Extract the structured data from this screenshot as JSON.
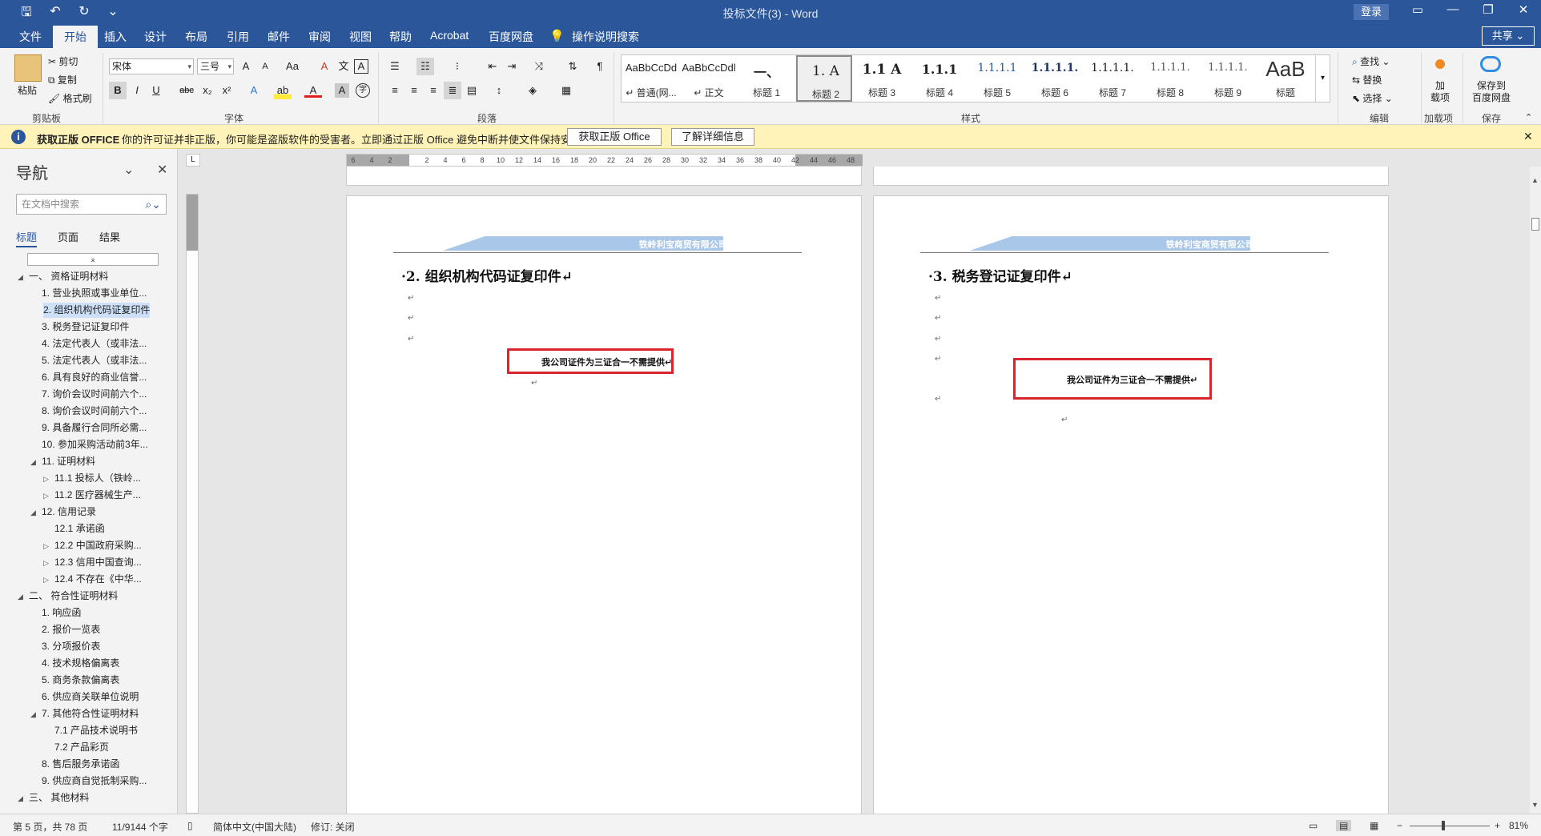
{
  "title_bar": {
    "doc_title": "投标文件(3)  -  Word",
    "login": "登录",
    "qat_icons": [
      "save-icon",
      "undo-icon",
      "redo-icon",
      "customize-icon"
    ],
    "save": "🖫",
    "undo": "↶",
    "redo": "↻",
    "customize": "⌄",
    "ribbon_display": "▭",
    "minimize": "—",
    "restore": "❐",
    "close": "✕"
  },
  "tabs": {
    "file": "文件",
    "home": "开始",
    "insert": "插入",
    "design": "设计",
    "layout": "布局",
    "references": "引用",
    "mailings": "邮件",
    "review": "审阅",
    "view": "视图",
    "help": "帮助",
    "acrobat": "Acrobat",
    "baidu": "百度网盘",
    "tell_me": "操作说明搜索",
    "share": "共享 ⌄"
  },
  "ribbon": {
    "clipboard": {
      "paste": "粘贴",
      "cut": "剪切",
      "copy": "复制",
      "format_painter": "格式刷",
      "label": "剪贴板"
    },
    "font": {
      "name": "宋体",
      "size": "三号",
      "label": "字体",
      "grow": "A",
      "shrink": "A",
      "case": "Aa",
      "clear": "A",
      "phonetic": "文",
      "border": "A",
      "bold": "B",
      "italic": "I",
      "underline": "U",
      "strike": "abc",
      "sub": "x₂",
      "sup": "x²",
      "effects": "A",
      "highlight": "ab",
      "color": "A",
      "shade": "A",
      "enclose": "字"
    },
    "paragraph": {
      "label": "段落"
    },
    "styles": {
      "label": "样式",
      "items": [
        {
          "preview": "AaBbCcDd",
          "name": "↵ 普通(网..."
        },
        {
          "preview": "AaBbCcDdl",
          "name": "↵ 正文"
        },
        {
          "preview": "一、",
          "name": "标题 1"
        },
        {
          "preview": "1.  A",
          "name": "标题 2"
        },
        {
          "preview": "1.1  A",
          "name": "标题 3"
        },
        {
          "preview": "1.1.1",
          "name": "标题 4"
        },
        {
          "preview": "1.1.1.1",
          "name": "标题 5"
        },
        {
          "preview": "1.1.1.1.",
          "name": "标题 6"
        },
        {
          "preview": "1.1.1.1.",
          "name": "标题 7"
        },
        {
          "preview": "1.1.1.1.",
          "name": "标题 8"
        },
        {
          "preview": "1.1.1.1.",
          "name": "标题 9"
        },
        {
          "preview": "AaB",
          "name": "标题"
        }
      ]
    },
    "editing": {
      "find": "查找",
      "replace": "替换",
      "select": "选择",
      "label": "编辑"
    },
    "addins": {
      "button": "加\n载项",
      "label": "加载项"
    },
    "save_baidu": {
      "button": "保存到\n百度网盘",
      "label": "保存"
    }
  },
  "infobar": {
    "title": "获取正版 OFFICE",
    "message": "你的许可证并非正版，你可能是盗版软件的受害者。立即通过正版 Office 避免中断并使文件保持安全。",
    "btn_get": "获取正版 Office",
    "btn_learn": "了解详细信息"
  },
  "nav": {
    "title": "导航",
    "search_placeholder": "在文档中搜索",
    "tabs": {
      "headings": "标题",
      "pages": "页面",
      "results": "结果"
    },
    "items": [
      {
        "text": "一、 资格证明材料",
        "level": 0,
        "tw": "◢"
      },
      {
        "text": "1. 营业执照或事业单位...",
        "level": 1,
        "tw": ""
      },
      {
        "text": "2. 组织机构代码证复印件",
        "level": 1,
        "tw": "",
        "selected": true
      },
      {
        "text": "3. 税务登记证复印件",
        "level": 1,
        "tw": ""
      },
      {
        "text": "4. 法定代表人（或非法...",
        "level": 1,
        "tw": ""
      },
      {
        "text": "5. 法定代表人（或非法...",
        "level": 1,
        "tw": ""
      },
      {
        "text": "6. 具有良好的商业信誉...",
        "level": 1,
        "tw": ""
      },
      {
        "text": "7. 询价会议时间前六个...",
        "level": 1,
        "tw": ""
      },
      {
        "text": "8. 询价会议时间前六个...",
        "level": 1,
        "tw": ""
      },
      {
        "text": "9. 具备履行合同所必需...",
        "level": 1,
        "tw": ""
      },
      {
        "text": "10. 参加采购活动前3年...",
        "level": 1,
        "tw": ""
      },
      {
        "text": "11. 证明材料",
        "level": 1,
        "tw": "◢"
      },
      {
        "text": "11.1 投标人（铁岭...",
        "level": 2,
        "tw": "▷"
      },
      {
        "text": "11.2 医疗器械生产...",
        "level": 2,
        "tw": "▷"
      },
      {
        "text": "12. 信用记录",
        "level": 1,
        "tw": "◢"
      },
      {
        "text": "12.1 承诺函",
        "level": 2,
        "tw": ""
      },
      {
        "text": "12.2 中国政府采购...",
        "level": 2,
        "tw": "▷"
      },
      {
        "text": "12.3 信用中国查询...",
        "level": 2,
        "tw": "▷"
      },
      {
        "text": "12.4 不存在《中华...",
        "level": 2,
        "tw": "▷"
      },
      {
        "text": "二、 符合性证明材料",
        "level": 0,
        "tw": "◢"
      },
      {
        "text": "1. 响应函",
        "level": 1,
        "tw": ""
      },
      {
        "text": "2. 报价一览表",
        "level": 1,
        "tw": ""
      },
      {
        "text": "3. 分项报价表",
        "level": 1,
        "tw": ""
      },
      {
        "text": "4. 技术规格偏离表",
        "level": 1,
        "tw": ""
      },
      {
        "text": "5. 商务条款偏离表",
        "level": 1,
        "tw": ""
      },
      {
        "text": "6. 供应商关联单位说明",
        "level": 1,
        "tw": ""
      },
      {
        "text": "7. 其他符合性证明材料",
        "level": 1,
        "tw": "◢"
      },
      {
        "text": "7.1 产品技术说明书",
        "level": 2,
        "tw": ""
      },
      {
        "text": "7.2 产品彩页",
        "level": 2,
        "tw": ""
      },
      {
        "text": "8. 售后服务承诺函",
        "level": 1,
        "tw": ""
      },
      {
        "text": "9. 供应商自觉抵制采购...",
        "level": 1,
        "tw": ""
      },
      {
        "text": "三、 其他材料",
        "level": 0,
        "tw": "◢"
      }
    ]
  },
  "ruler": {
    "ticks": [
      "6",
      "4",
      "2",
      "",
      "2",
      "4",
      "6",
      "8",
      "10",
      "12",
      "14",
      "16",
      "18",
      "20",
      "22",
      "24",
      "26",
      "28",
      "30",
      "32",
      "34",
      "36",
      "38",
      "40",
      "42",
      "44",
      "46",
      "48"
    ]
  },
  "pages": {
    "company": "铁岭利宝商贸有限公司↵",
    "page1": {
      "heading": "·2.  组织机构代码证复印件↵",
      "box_text": "我公司证件为三证合一不需提供↵"
    },
    "page2": {
      "heading": "·3.  税务登记证复印件↵",
      "box_text": "我公司证件为三证合一不需提供↵"
    },
    "para_mark": "↵"
  },
  "status": {
    "page": "第 5 页，共 78 页",
    "words": "11/9144 个字",
    "lang": "简体中文(中国大陆)",
    "track": "修订: 关闭",
    "zoom": "81%",
    "zoom_out": "−",
    "zoom_in": "+"
  }
}
